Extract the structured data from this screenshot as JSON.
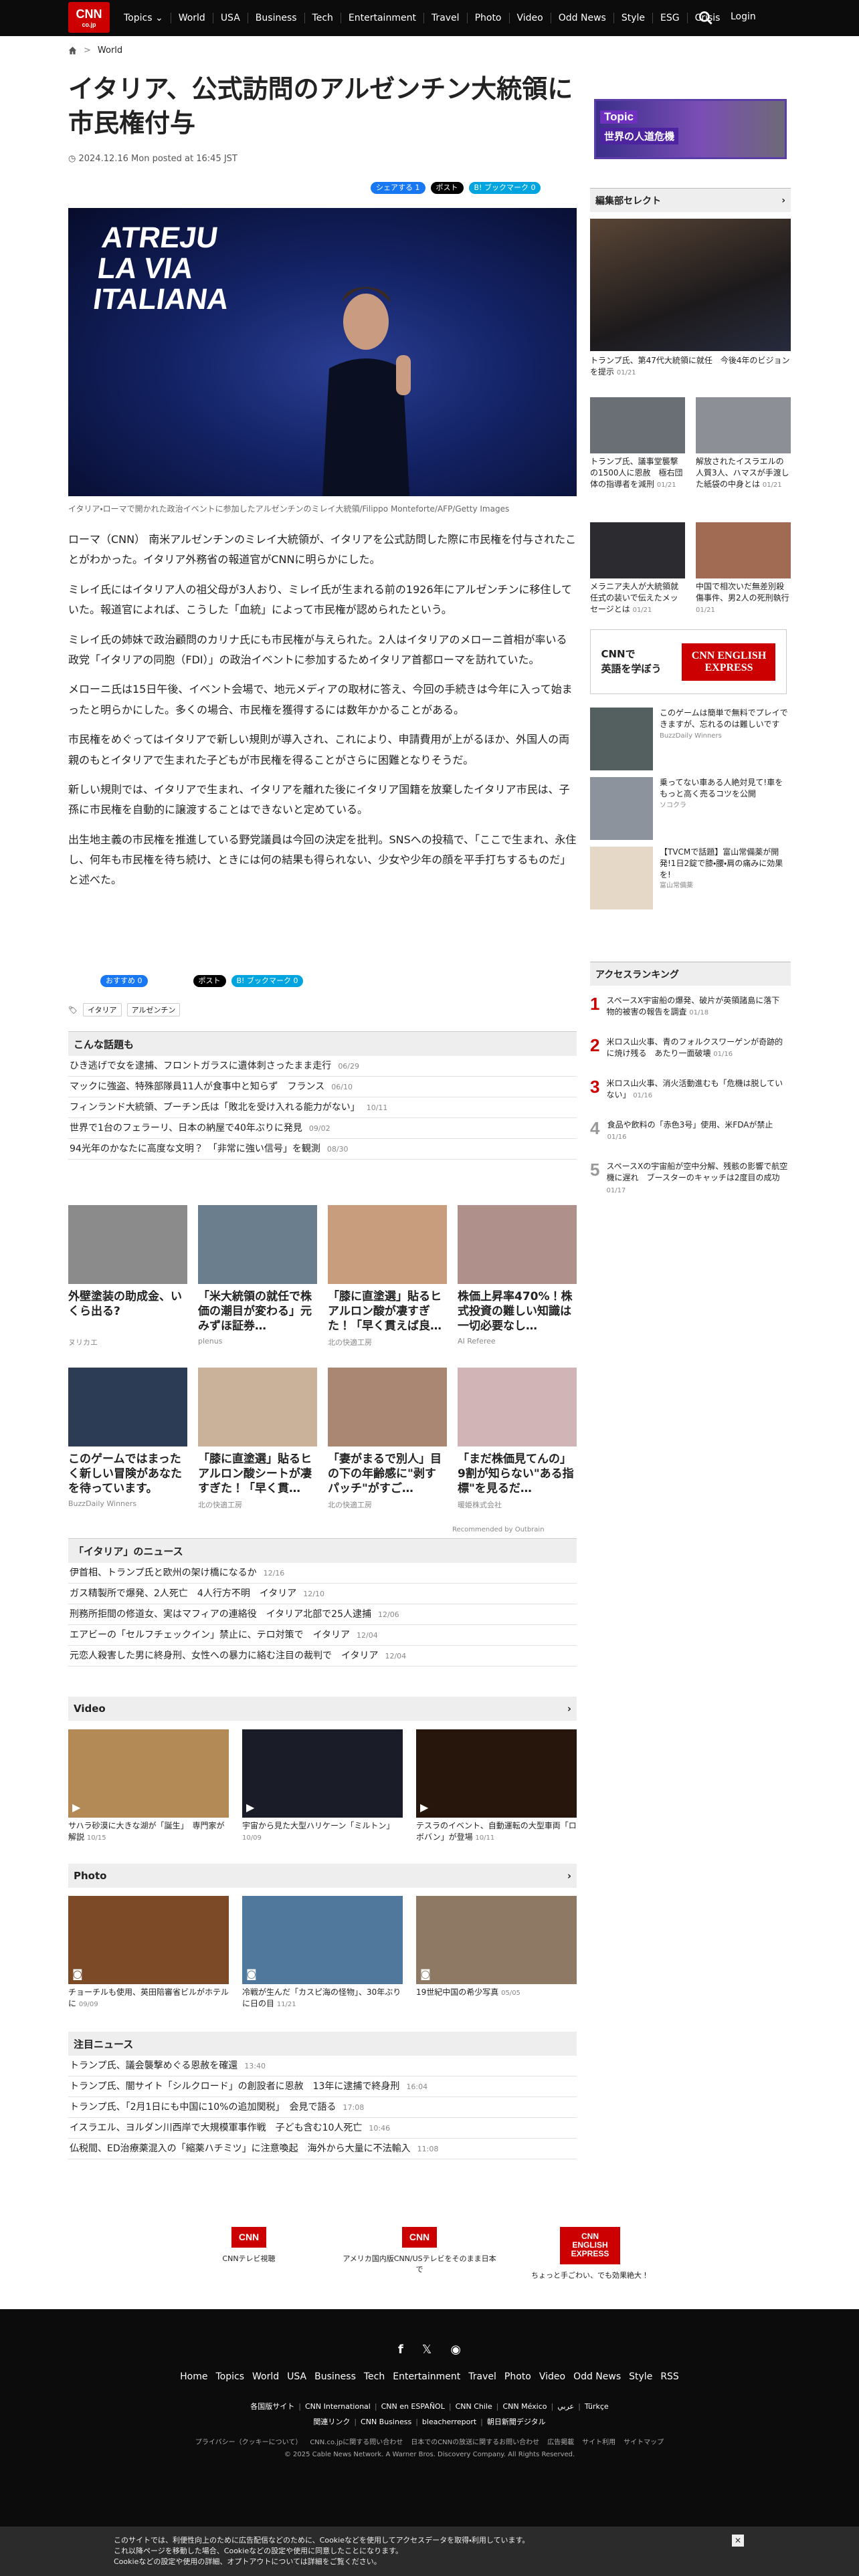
{
  "header": {
    "logo": "CNN",
    "logo_sub": "co.jp",
    "nav": [
      "Topics",
      "World",
      "USA",
      "Business",
      "Tech",
      "Entertainment",
      "Travel",
      "Photo",
      "Video",
      "Odd News",
      "Style",
      "ESG",
      "Crisis"
    ],
    "login": "Login"
  },
  "breadcrumb": "World",
  "article": {
    "title": "イタリア、公式訪問のアルゼンチン大統領に市民権付与",
    "date": "2024.12.16 Mon posted at 16:45 JST",
    "share": {
      "fb": "シェアする 1",
      "x": "ポスト",
      "hatena": "B! ブックマーク 0"
    },
    "share2": {
      "fb": "おすすめ 0",
      "x": "ポスト",
      "hatena": "B! ブックマーク 0"
    },
    "hero_slogan": [
      "ATREJU",
      "LA VIA",
      "ITALIANA"
    ],
    "caption": "イタリア・ローマで開かれた政治イベントに参加したアルゼンチンのミレイ大統領/Filippo Monteforte/AFP/Getty Images",
    "paragraphs": [
      "ローマ（CNN） 南米アルゼンチンのミレイ大統領が、イタリアを公式訪問した際に市民権を付与されたことがわかった。イタリア外務省の報道官がCNNに明らかにした。",
      "ミレイ氏にはイタリア人の祖父母が3人おり、ミレイ氏が生まれる前の1926年にアルゼンチンに移住していた。報道官によれば、こうした「血統」によって市民権が認められたという。",
      "ミレイ氏の姉妹で政治顧問のカリナ氏にも市民権が与えられた。2人はイタリアのメローニ首相が率いる政党「イタリアの同胞（FDI）」の政治イベントに参加するためイタリア首都ローマを訪れていた。",
      "メローニ氏は15日午後、イベント会場で、地元メディアの取材に答え、今回の手続きは今年に入って始まったと明らかにした。多くの場合、市民権を獲得するには数年かかることがある。",
      "市民権をめぐってはイタリアで新しい規則が導入され、これにより、申請費用が上がるほか、外国人の両親のもとイタリアで生まれた子どもが市民権を得ることがさらに困難となりそうだ。",
      "新しい規則では、イタリアで生まれ、イタリアを離れた後にイタリア国籍を放棄したイタリア市民は、子孫に市民権を自動的に譲渡することはできないと定めている。",
      "出生地主義の市民権を推進している野党議員は今回の決定を批判。SNSへの投稿で、「ここで生まれ、永住し、何年も市民権を待ち続け、ときには何の結果も得られない、少女や少年の顔を平手打ちするものだ」と述べた。"
    ],
    "tags": [
      "イタリア",
      "アルゼンチン"
    ]
  },
  "konna": {
    "title": "こんな話題も",
    "items": [
      {
        "t": "ひき逃げで女を逮捕、フロントガラスに遺体刺さったまま走行",
        "d": "06/29"
      },
      {
        "t": "マックに強盗、特殊部隊員11人が食事中と知らず　フランス",
        "d": "06/10"
      },
      {
        "t": "フィンランド大統領、プーチン氏は「敗北を受け入れる能力がない」",
        "d": "10/11"
      },
      {
        "t": "世界で1台のフェラーリ、日本の納屋で40年ぶりに発見",
        "d": "09/02"
      },
      {
        "t": "94光年のかなたに高度な文明？　「非常に強い信号」を観測",
        "d": "08/30"
      }
    ]
  },
  "promo": [
    {
      "t": "外壁塗装の助成金、いくら出る?",
      "s": "ヌリカエ",
      "c": "#8b8b8b",
      "i": "house-icon"
    },
    {
      "t": "「米大統領の就任で株価の潮目が変わる」元みずほ証券…",
      "s": "plenus",
      "c": "#6b7e8e",
      "i": "person-icon"
    },
    {
      "t": "「膝に直塗選」貼るヒアルロン酸が凄すぎた！「早く貫えば良…",
      "s": "北の快適工房",
      "c": "#c79d7d",
      "i": "knee-icon"
    },
    {
      "t": "株価上昇率470%！株式投資の難しい知識は一切必要なし…",
      "s": "AI Referee",
      "c": "#b0908a",
      "i": "phone-icon"
    },
    {
      "t": "このゲームではまったく新しい冒険があなたを待っています。",
      "s": "BuzzDaily Winners",
      "c": "#2d3c55",
      "i": "game-icon"
    },
    {
      "t": "「膝に直塗選」貼るヒアルロン酸シートが凄すぎた！「早く貫…",
      "s": "北の快適工房",
      "c": "#c9b19a",
      "i": "knee-icon"
    },
    {
      "t": "「妻がまるで別人」目の下の年齢感に\"剥すパッチ\"がすご…",
      "s": "北の快適工房",
      "c": "#aa8772",
      "i": "eye-icon"
    },
    {
      "t": "「まだ株価見てんの」9割が知らない\"ある指標\"を見るだ…",
      "s": "暖姫株式会社",
      "c": "#d1b5b6",
      "i": "woman-icon"
    }
  ],
  "outbrain": "Recommended by Outbrain",
  "italy": {
    "title": "「イタリア」のニュース",
    "items": [
      {
        "t": "伊首相、トランプ氏と欧州の架け橋になるか",
        "d": "12/16"
      },
      {
        "t": "ガス精製所で爆発、2人死亡　4人行方不明　イタリア",
        "d": "12/10"
      },
      {
        "t": "刑務所拒間の修道女、実はマフィアの連絡役　イタリア北部で25人逮捕",
        "d": "12/06"
      },
      {
        "t": "エアビーの「セルフチェックイン」禁止に、テロ対策で　イタリア",
        "d": "12/04"
      },
      {
        "t": "元恋人殺害した男に終身刑、女性への暴力に絡む注目の裁判で　イタリア",
        "d": "12/04"
      }
    ]
  },
  "video": {
    "title": "Video",
    "items": [
      {
        "t": "サハラ砂漠に大きな湖が「誕生」　専門家が解説",
        "d": "10/15",
        "c": "#b38a55"
      },
      {
        "t": "宇宙から見た大型ハリケーン「ミルトン」",
        "d": "10/09",
        "c": "#1a1d28"
      },
      {
        "t": "テスラのイベント、自動運転の大型車両「ロボバン」が登場",
        "d": "10/11",
        "c": "#26160c"
      }
    ]
  },
  "photo": {
    "title": "Photo",
    "items": [
      {
        "t": "チョーチルも使用、英田陪審省ビルがホテルに",
        "d": "09/09",
        "c": "#7c4a27"
      },
      {
        "t": "冷戦が生んだ「カスピ海の怪物」、30年ぶりに日の目",
        "d": "11/21",
        "c": "#50779c"
      },
      {
        "t": "19世紀中国の希少写真",
        "d": "05/05",
        "c": "#8e7a64"
      }
    ]
  },
  "chumoku": {
    "title": "注目ニュース",
    "items": [
      {
        "t": "トランプ氏、議会襲撃めぐる恩赦を確還",
        "d": "13:40"
      },
      {
        "t": "トランプ氏、闇サイト「シルクロード」の創設者に恩赦　13年に逮捕で終身刑",
        "d": "16:04"
      },
      {
        "t": "トランプ氏、「2月1日にも中国に10%の追加関税」　会見で語る",
        "d": "17:08"
      },
      {
        "t": "イスラエル、ヨルダン川西岸で大規模軍事作戦　子ども含む10人死亡",
        "d": "10:46"
      },
      {
        "t": "仏税間、ED治療薬混入の「縮薬ハチミツ」に注意喚起　海外から大量に不法輸入",
        "d": "11:08"
      }
    ]
  },
  "banners": [
    {
      "l": "CNN",
      "t": "CNNテレビ視聴"
    },
    {
      "l": "CNN",
      "t": "アメリカ国内版CNN/USテレビをそのまま日本で"
    },
    {
      "l": "CNN ENGLISH EXPRESS",
      "t": "ちょっと手ごわい、でも効果絶大！"
    }
  ],
  "sidebar": {
    "topic_label": "Topic",
    "topic_title": "世界の人道危機",
    "editor_title": "編集部セレクト",
    "main": {
      "t": "トランプ氏、第47代大統領に就任　今後4年のビジョンを提示",
      "d": "01/21"
    },
    "grid": [
      {
        "t": "トランプ氏、議事堂襲撃の1500人に恩赦　極右団体の指導者を減刑",
        "d": "01/21",
        "c": "#6a6e75"
      },
      {
        "t": "解放されたイスラエルの人質3人、ハマスが手渡した紙袋の中身とは",
        "d": "01/21",
        "c": "#8c8f95"
      },
      {
        "t": "メラニア夫人が大統領就任式の装いで伝えたメッセージとは",
        "d": "01/21",
        "c": "#2b2b30"
      },
      {
        "t": "中国で相次いだ無差別殺傷事件、男2人の死刑執行",
        "d": "01/21",
        "c": "#a06b52"
      }
    ],
    "english_ad": {
      "a": "CNNで",
      "b": "英語を学ぼう",
      "logo": "CNN ENGLISH EXPRESS"
    },
    "ads": [
      {
        "t": "このゲームは簡単で無料でプレイできますが、忘れるのは難しいです",
        "s": "BuzzDaily Winners",
        "c": "#54605f"
      },
      {
        "t": "乗ってない車ある人絶対見て!車をもっと高く売るコツを公開",
        "s": "ソコクラ",
        "c": "#8c939c"
      },
      {
        "t": "【TVCMで話題】富山常備薬が開発!1日2錠で膝・腰・肩の痛みに効果を!",
        "s": "富山常備薬",
        "c": "#e5d8c7"
      }
    ],
    "ranking_title": "アクセスランキング",
    "ranking": [
      {
        "n": "1",
        "t": "スペースX宇宙船の爆発、破片が英領諸島に落下　物的被害の報告を調査",
        "d": "01/18"
      },
      {
        "n": "2",
        "t": "米ロス山火事、青のフォルクスワーゲンが奇跡的に焼け残る　あたり一面破壊",
        "d": "01/16"
      },
      {
        "n": "3",
        "t": "米ロス山火事、消火活動進むも「危機は脱していない」",
        "d": "01/16"
      },
      {
        "n": "4",
        "t": "食品や飲料の「赤色3号」使用、米FDAが禁止",
        "d": "01/16"
      },
      {
        "n": "5",
        "t": "スペースXの宇宙船が空中分解、残骸の影響で航空機に遅れ　ブースターのキャッチは2度目の成功",
        "d": "01/17"
      }
    ]
  },
  "footer": {
    "nav": [
      "Home",
      "Topics",
      "World",
      "USA",
      "Business",
      "Tech",
      "Entertainment",
      "Travel",
      "Photo",
      "Video",
      "Odd News",
      "Style",
      "RSS"
    ],
    "sites": [
      "各国版サイト",
      "CNN International",
      "CNN en ESPAÑOL",
      "CNN Chile",
      "CNN México",
      "عربي",
      "Türkçe"
    ],
    "related": [
      "関連リンク",
      "CNN Business",
      "bleacherreport",
      "朝日新聞デジタル"
    ],
    "legal": [
      "プライバシー（クッキーについて）",
      "CNN.co.jpに関する問い合わせ",
      "日本でのCNNの放送に関するお問い合わせ",
      "広告掲載",
      "サイト利用",
      "サイトマップ"
    ],
    "copy": "© 2025 Cable News Network. A Warner Bros. Discovery Company. All Rights Reserved."
  },
  "cookie": {
    "lines": [
      "このサイトでは、利便性向上のために広告配信などのために、Cookieなどを使用してアクセスデータを取得・利用しています。",
      "これ以降ページを移動した場合、Cookieなどの設定や使用に同意したことになります。",
      "Cookieなどの設定や使用の詳細、オプトアウトについては詳細をご覧ください。"
    ],
    "close": "✕"
  }
}
